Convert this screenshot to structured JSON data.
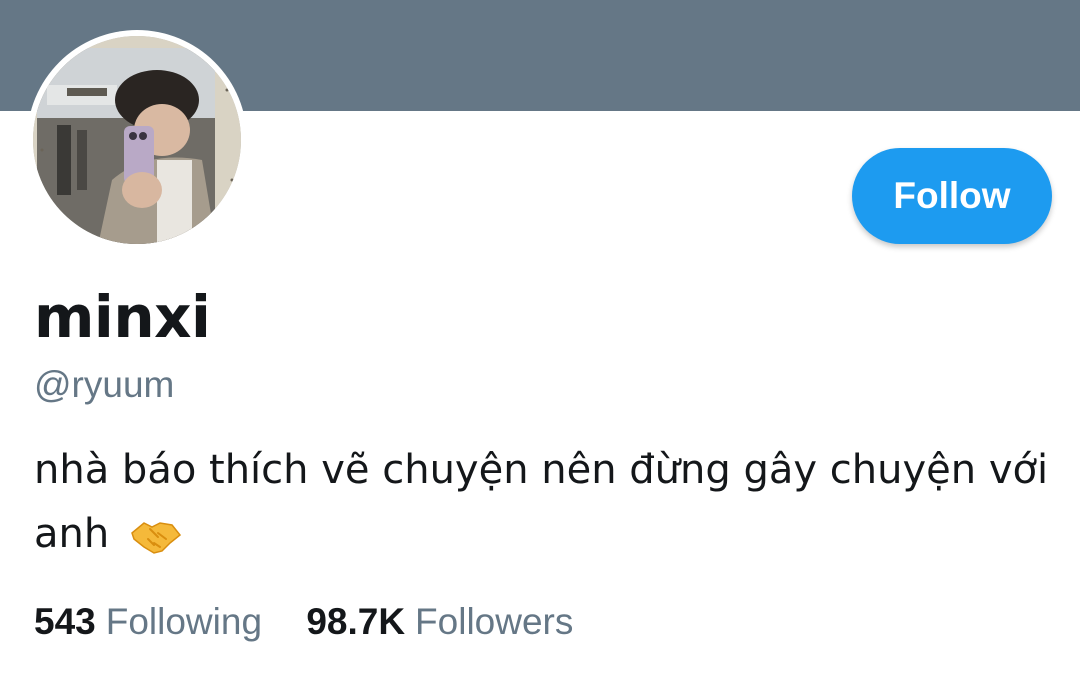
{
  "profile": {
    "display_name": "minxi",
    "handle": "@ryuum",
    "bio": "nhà báo thích vẽ chuyện nên đừng gây chuyện với anh",
    "bio_emoji": "handshake-icon"
  },
  "actions": {
    "follow_label": "Follow"
  },
  "stats": {
    "following_count": "543",
    "following_label": "Following",
    "followers_count": "98.7K",
    "followers_label": "Followers"
  },
  "colors": {
    "banner": "#657786",
    "accent": "#1d9bf0",
    "text_primary": "#14171a",
    "text_secondary": "#657786"
  }
}
